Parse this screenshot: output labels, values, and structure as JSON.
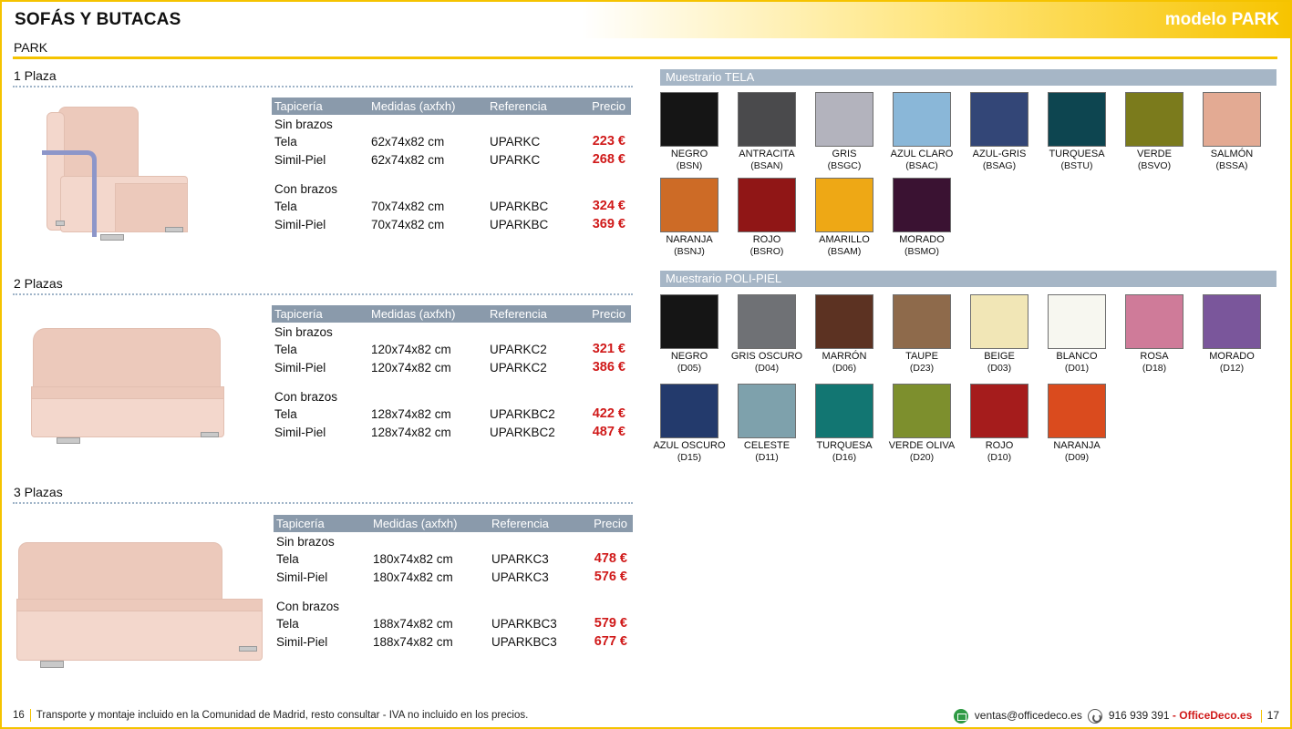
{
  "header": {
    "title": "SOFÁS Y BUTACAS",
    "model": "modelo PARK"
  },
  "subtitle": "PARK",
  "table_headers": {
    "tapiceria": "Tapicería",
    "medidas": "Medidas (axfxh)",
    "referencia": "Referencia",
    "precio": "Precio"
  },
  "sections": [
    {
      "title": "1 Plaza",
      "groups": [
        {
          "label": "Sin brazos",
          "rows": [
            {
              "tapiceria": "Tela",
              "medidas": "62x74x82 cm",
              "referencia": "UPARKC",
              "precio": "223 €"
            },
            {
              "tapiceria": "Simil-Piel",
              "medidas": "62x74x82 cm",
              "referencia": "UPARKC",
              "precio": "268 €"
            }
          ]
        },
        {
          "label": "Con brazos",
          "rows": [
            {
              "tapiceria": "Tela",
              "medidas": "70x74x82 cm",
              "referencia": "UPARKBC",
              "precio": "324 €"
            },
            {
              "tapiceria": "Simil-Piel",
              "medidas": "70x74x82 cm",
              "referencia": "UPARKBC",
              "precio": "369 €"
            }
          ]
        }
      ]
    },
    {
      "title": "2 Plazas",
      "groups": [
        {
          "label": "Sin brazos",
          "rows": [
            {
              "tapiceria": "Tela",
              "medidas": "120x74x82 cm",
              "referencia": "UPARKC2",
              "precio": "321 €"
            },
            {
              "tapiceria": "Simil-Piel",
              "medidas": "120x74x82 cm",
              "referencia": "UPARKC2",
              "precio": "386 €"
            }
          ]
        },
        {
          "label": "Con brazos",
          "rows": [
            {
              "tapiceria": "Tela",
              "medidas": "128x74x82 cm",
              "referencia": "UPARKBC2",
              "precio": "422 €"
            },
            {
              "tapiceria": "Simil-Piel",
              "medidas": "128x74x82 cm",
              "referencia": "UPARKBC2",
              "precio": "487 €"
            }
          ]
        }
      ]
    },
    {
      "title": "3 Plazas",
      "groups": [
        {
          "label": "Sin brazos",
          "rows": [
            {
              "tapiceria": "Tela",
              "medidas": "180x74x82 cm",
              "referencia": "UPARKC3",
              "precio": "478 €"
            },
            {
              "tapiceria": "Simil-Piel",
              "medidas": "180x74x82 cm",
              "referencia": "UPARKC3",
              "precio": "576 €"
            }
          ]
        },
        {
          "label": "Con brazos",
          "rows": [
            {
              "tapiceria": "Tela",
              "medidas": "188x74x82 cm",
              "referencia": "UPARKBC3",
              "precio": "579 €"
            },
            {
              "tapiceria": "Simil-Piel",
              "medidas": "188x74x82 cm",
              "referencia": "UPARKBC3",
              "precio": "677 €"
            }
          ]
        }
      ]
    }
  ],
  "muestrario_tela": {
    "title": "Muestrario TELA",
    "swatches": [
      {
        "name": "NEGRO",
        "code": "(BSN)",
        "color": "#151515"
      },
      {
        "name": "ANTRACITA",
        "code": "(BSAN)",
        "color": "#4a4a4c"
      },
      {
        "name": "GRIS",
        "code": "(BSGC)",
        "color": "#b3b3bd"
      },
      {
        "name": "AZUL CLARO",
        "code": "(BSAC)",
        "color": "#8ab7d8"
      },
      {
        "name": "AZUL-GRIS",
        "code": "(BSAG)",
        "color": "#334677"
      },
      {
        "name": "TURQUESA",
        "code": "(BSTU)",
        "color": "#0d4550"
      },
      {
        "name": "VERDE",
        "code": "(BSVO)",
        "color": "#7b7b1c"
      },
      {
        "name": "SALMÓN",
        "code": "(BSSA)",
        "color": "#e3aa93"
      },
      {
        "name": "NARANJA",
        "code": "(BSNJ)",
        "color": "#cd6b26"
      },
      {
        "name": "ROJO",
        "code": "(BSRO)",
        "color": "#901616"
      },
      {
        "name": "AMARILLO",
        "code": "(BSAM)",
        "color": "#eea815"
      },
      {
        "name": "MORADO",
        "code": "(BSMO)",
        "color": "#3a1232"
      }
    ]
  },
  "muestrario_polipiel": {
    "title": "Muestrario POLI-PIEL",
    "swatches": [
      {
        "name": "NEGRO",
        "code": "(D05)",
        "color": "#151515"
      },
      {
        "name": "GRIS OSCURO",
        "code": "(D04)",
        "color": "#6f7175"
      },
      {
        "name": "MARRÓN",
        "code": "(D06)",
        "color": "#5c3222"
      },
      {
        "name": "TAUPE",
        "code": "(D23)",
        "color": "#8e6a4b"
      },
      {
        "name": "BEIGE",
        "code": "(D03)",
        "color": "#f1e6b6"
      },
      {
        "name": "BLANCO",
        "code": "(D01)",
        "color": "#f7f7f0"
      },
      {
        "name": "ROSA",
        "code": "(D18)",
        "color": "#cf7b99"
      },
      {
        "name": "MORADO",
        "code": "(D12)",
        "color": "#7a569b"
      },
      {
        "name": "AZUL OSCURO",
        "code": "(D15)",
        "color": "#233a6c"
      },
      {
        "name": "CELESTE",
        "code": "(D11)",
        "color": "#7ea1ac"
      },
      {
        "name": "TURQUESA",
        "code": "(D16)",
        "color": "#127672"
      },
      {
        "name": "VERDE OLIVA",
        "code": "(D20)",
        "color": "#7d8f2d"
      },
      {
        "name": "ROJO",
        "code": "(D10)",
        "color": "#a51c1c"
      },
      {
        "name": "NARANJA",
        "code": "(D09)",
        "color": "#da4b1e"
      }
    ]
  },
  "footer": {
    "page_left": "16",
    "note": "Transporte y montaje incluido en la Comunidad de Madrid, resto consultar - IVA no incluido en los precios.",
    "email": "ventas@officedeco.es",
    "phone": "916 939 391",
    "dash": "-",
    "brand": "OfficeDeco.es",
    "page_right": "17"
  }
}
